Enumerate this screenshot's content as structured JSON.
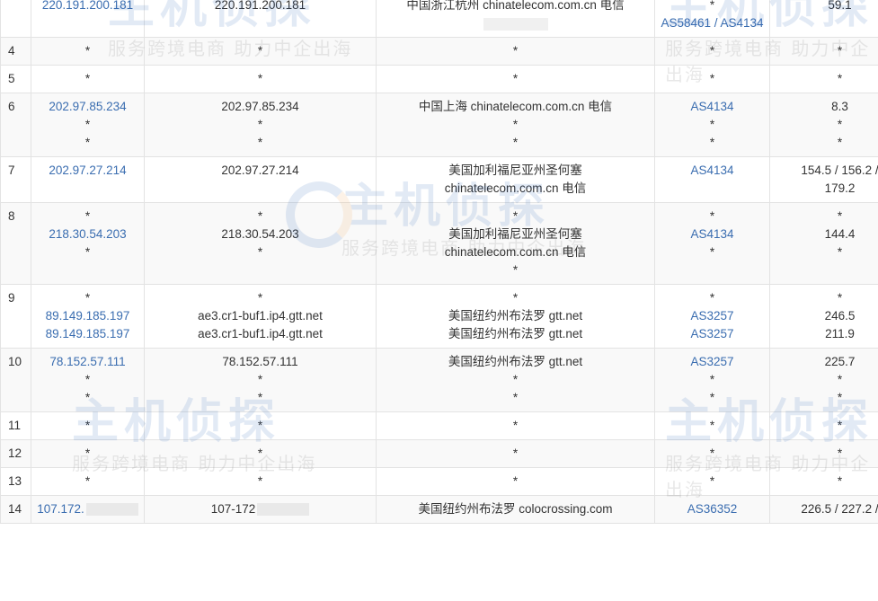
{
  "rows": [
    {
      "hop": "",
      "ip": [
        "220.191.200.181"
      ],
      "host": [
        "220.191.200.181"
      ],
      "location": [
        "中国浙江杭州 chinatelecom.com.cn 电信"
      ],
      "asn": [
        "*",
        "AS58461 / AS4134"
      ],
      "time": [
        "59.1"
      ],
      "partial_top": true
    },
    {
      "hop": "4",
      "ip": [
        "*"
      ],
      "host": [
        "*"
      ],
      "location": [
        "*"
      ],
      "asn": [
        "*"
      ],
      "time": [
        "*"
      ]
    },
    {
      "hop": "5",
      "ip": [
        "*"
      ],
      "host": [
        "*"
      ],
      "location": [
        "*"
      ],
      "asn": [
        "*"
      ],
      "time": [
        "*"
      ]
    },
    {
      "hop": "6",
      "ip": [
        "202.97.85.234",
        "*",
        "*"
      ],
      "host": [
        "202.97.85.234",
        "*",
        "*"
      ],
      "location": [
        "中国上海 chinatelecom.com.cn 电信",
        "*",
        "*"
      ],
      "asn": [
        "AS4134",
        "*",
        "*"
      ],
      "time": [
        "8.3",
        "*",
        "*"
      ]
    },
    {
      "hop": "7",
      "ip": [
        "202.97.27.214"
      ],
      "host": [
        "202.97.27.214"
      ],
      "location": [
        "美国加利福尼亚州圣何塞",
        "chinatelecom.com.cn 电信"
      ],
      "asn": [
        "AS4134"
      ],
      "time": [
        "154.5 / 156.2 /",
        "179.2"
      ]
    },
    {
      "hop": "8",
      "ip": [
        "*",
        "218.30.54.203",
        "*"
      ],
      "host": [
        "*",
        "218.30.54.203",
        "*"
      ],
      "location": [
        "*",
        "美国加利福尼亚州圣何塞",
        "chinatelecom.com.cn 电信",
        "*"
      ],
      "asn": [
        "*",
        "AS4134",
        "*"
      ],
      "time": [
        "*",
        "144.4",
        "*"
      ]
    },
    {
      "hop": "9",
      "ip": [
        "*",
        "89.149.185.197",
        "89.149.185.197"
      ],
      "host": [
        "*",
        "ae3.cr1-buf1.ip4.gtt.net",
        "ae3.cr1-buf1.ip4.gtt.net"
      ],
      "location": [
        "*",
        "美国纽约州布法罗 gtt.net",
        "美国纽约州布法罗 gtt.net"
      ],
      "asn": [
        "*",
        "AS3257",
        "AS3257"
      ],
      "time": [
        "*",
        "246.5",
        "211.9"
      ]
    },
    {
      "hop": "10",
      "ip": [
        "78.152.57.111",
        "*",
        "*"
      ],
      "host": [
        "78.152.57.111",
        "*",
        "*"
      ],
      "location": [
        "美国纽约州布法罗 gtt.net",
        "*",
        "*"
      ],
      "asn": [
        "AS3257",
        "*",
        "*"
      ],
      "time": [
        "225.7",
        "*",
        "*"
      ]
    },
    {
      "hop": "11",
      "ip": [
        "*"
      ],
      "host": [
        "*"
      ],
      "location": [
        "*"
      ],
      "asn": [
        "*"
      ],
      "time": [
        "*"
      ]
    },
    {
      "hop": "12",
      "ip": [
        "*"
      ],
      "host": [
        "*"
      ],
      "location": [
        "*"
      ],
      "asn": [
        "*"
      ],
      "time": [
        "*"
      ]
    },
    {
      "hop": "13",
      "ip": [
        "*"
      ],
      "host": [
        "*"
      ],
      "location": [
        "*"
      ],
      "asn": [
        "*"
      ],
      "time": [
        "*"
      ]
    },
    {
      "hop": "14",
      "ip": [
        "107.172."
      ],
      "host": [
        "107-172"
      ],
      "location": [
        "美国纽约州布法罗 colocrossing.com"
      ],
      "asn": [
        "AS36352"
      ],
      "time": [
        "226.5 / 227.2 /"
      ],
      "partial_bottom": true
    }
  ],
  "watermark": {
    "logo_text": "主机侦探",
    "slogan": "服务跨境电商 助力中企出海"
  },
  "colors": {
    "link": "#3a6db0",
    "text": "#333333",
    "border": "#e3e3e3",
    "stripe": "#f9f9f9",
    "watermark": "#2c64b8"
  }
}
